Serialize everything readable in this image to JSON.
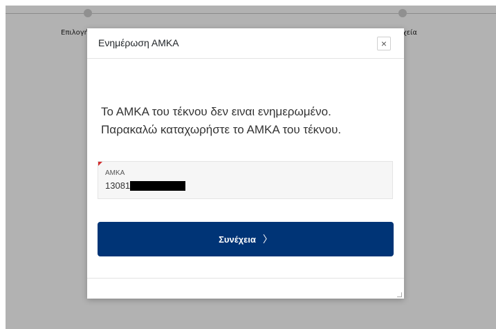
{
  "stepper": {
    "steps": [
      {
        "label": "Επιλογή Παιδιού"
      },
      {
        "label": "Στοιχεία"
      }
    ]
  },
  "modal": {
    "title": "Ενημέρωση ΑΜΚΑ",
    "close_symbol": "×",
    "message_line1": "Το ΑΜΚΑ του τέκνου δεν ειναι ενημερωμένο.",
    "message_line2": "Παρακαλώ καταχωρήστε το ΑΜΚΑ του τέκνου.",
    "amka_field": {
      "label": "ΑΜΚΑ",
      "value_visible": "13081",
      "value_redacted": true
    },
    "continue_button": {
      "label": "Συνέχεια",
      "icon": "chevron-right-icon",
      "chevron_symbol": "〉"
    }
  },
  "colors": {
    "primary": "#003476",
    "required_marker": "#d32f2f",
    "overlay": "rgba(0,0,0,0.30)"
  }
}
